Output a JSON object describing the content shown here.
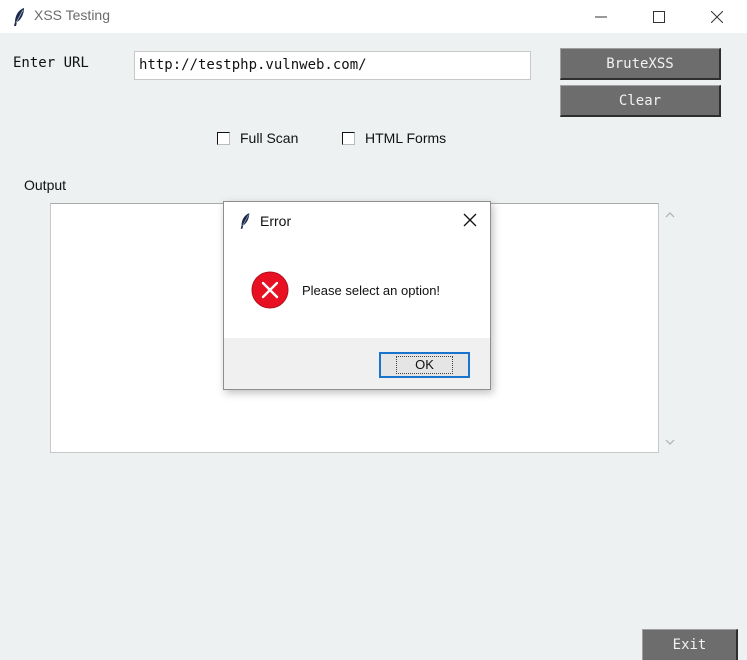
{
  "window": {
    "title": "XSS Testing",
    "icon": "feather-icon",
    "controls": [
      "minimize",
      "maximize",
      "close"
    ]
  },
  "form": {
    "url_label": "Enter URL",
    "url_value": "http://testphp.vulnweb.com/",
    "brute_button": "BruteXSS",
    "clear_button": "Clear",
    "options": [
      {
        "label": "Full Scan",
        "checked": false
      },
      {
        "label": "HTML Forms",
        "checked": false
      }
    ],
    "output_label": "Output",
    "output_text": "",
    "exit_button": "Exit"
  },
  "dialog": {
    "title": "Error",
    "icon": "feather-icon",
    "message_icon": "error-icon",
    "message": "Please select an option!",
    "ok_button": "OK"
  },
  "colors": {
    "window_bg": "#edf1f1",
    "button_bg": "#6d6d6d",
    "error_red": "#e81123",
    "focus_blue": "#1874cd"
  }
}
